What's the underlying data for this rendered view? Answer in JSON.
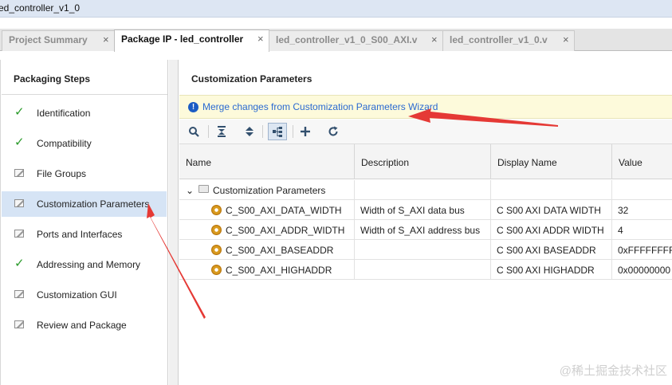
{
  "window": {
    "title": "ed_controller_v1_0"
  },
  "tabs": [
    {
      "label": "Project Summary",
      "close": "×",
      "active": false
    },
    {
      "label": "Package IP - led_controller",
      "close": "×",
      "active": true
    },
    {
      "label": "led_controller_v1_0_S00_AXI.v",
      "close": "×",
      "active": false
    },
    {
      "label": "led_controller_v1_0.v",
      "close": "×",
      "active": false
    }
  ],
  "sidebar": {
    "title": "Packaging Steps",
    "steps": [
      {
        "label": "Identification",
        "icon": "check-icon",
        "selected": false
      },
      {
        "label": "Compatibility",
        "icon": "check-icon",
        "selected": false
      },
      {
        "label": "File Groups",
        "icon": "edit-icon",
        "selected": false
      },
      {
        "label": "Customization Parameters",
        "icon": "edit-icon",
        "selected": true
      },
      {
        "label": "Ports and Interfaces",
        "icon": "edit-icon",
        "selected": false
      },
      {
        "label": "Addressing and Memory",
        "icon": "check-icon",
        "selected": false
      },
      {
        "label": "Customization GUI",
        "icon": "edit-icon",
        "selected": false
      },
      {
        "label": "Review and Package",
        "icon": "edit-icon",
        "selected": false
      }
    ]
  },
  "main": {
    "title": "Customization Parameters",
    "banner": {
      "icon": "info-icon",
      "link": "Merge changes from Customization Parameters Wizard"
    },
    "toolbar": [
      "search-icon",
      "collapse-all-icon",
      "expand-all-icon",
      "hierarchy-icon",
      "add-icon",
      "refresh-icon"
    ],
    "table": {
      "columns": [
        "Name",
        "Description",
        "Display Name",
        "Value"
      ],
      "group": "Customization Parameters",
      "rows": [
        {
          "name": "C_S00_AXI_DATA_WIDTH",
          "description": "Width of S_AXI data bus",
          "display": "C S00 AXI DATA WIDTH",
          "value": "32"
        },
        {
          "name": "C_S00_AXI_ADDR_WIDTH",
          "description": "Width of S_AXI address bus",
          "display": "C S00 AXI ADDR WIDTH",
          "value": "4"
        },
        {
          "name": "C_S00_AXI_BASEADDR",
          "description": "",
          "display": "C S00 AXI BASEADDR",
          "value": "0xFFFFFFFF"
        },
        {
          "name": "C_S00_AXI_HIGHADDR",
          "description": "",
          "display": "C S00 AXI HIGHADDR",
          "value": "0x00000000"
        }
      ]
    }
  },
  "watermark": "@稀土掘金技术社区",
  "colors": {
    "selection": "#d6e4f5",
    "banner": "#fdfadb",
    "link": "#2b6ad1",
    "arrow": "#e53935",
    "check": "#2a9a2a"
  }
}
